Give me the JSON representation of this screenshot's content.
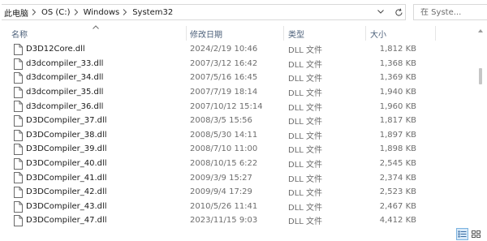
{
  "breadcrumb": {
    "items": [
      "此电脑",
      "OS (C:)",
      "Windows",
      "System32"
    ]
  },
  "search": {
    "placeholder": "在 Syste..."
  },
  "columns": {
    "name": "名称",
    "date": "修改日期",
    "type": "类型",
    "size": "大小"
  },
  "files": [
    {
      "name": "D3D12Core.dll",
      "date": "2024/2/19 10:46",
      "type": "DLL 文件",
      "size": "1,812 KB"
    },
    {
      "name": "d3dcompiler_33.dll",
      "date": "2007/3/12 16:42",
      "type": "DLL 文件",
      "size": "1,368 KB"
    },
    {
      "name": "d3dcompiler_34.dll",
      "date": "2007/5/16 16:45",
      "type": "DLL 文件",
      "size": "1,369 KB"
    },
    {
      "name": "d3dcompiler_35.dll",
      "date": "2007/7/19 18:14",
      "type": "DLL 文件",
      "size": "1,940 KB"
    },
    {
      "name": "d3dcompiler_36.dll",
      "date": "2007/10/12 15:14",
      "type": "DLL 文件",
      "size": "1,960 KB"
    },
    {
      "name": "D3DCompiler_37.dll",
      "date": "2008/3/5 15:56",
      "type": "DLL 文件",
      "size": "1,817 KB"
    },
    {
      "name": "D3DCompiler_38.dll",
      "date": "2008/5/30 14:11",
      "type": "DLL 文件",
      "size": "1,897 KB"
    },
    {
      "name": "D3DCompiler_39.dll",
      "date": "2008/7/10 11:00",
      "type": "DLL 文件",
      "size": "1,898 KB"
    },
    {
      "name": "D3DCompiler_40.dll",
      "date": "2008/10/15 6:22",
      "type": "DLL 文件",
      "size": "2,545 KB"
    },
    {
      "name": "D3DCompiler_41.dll",
      "date": "2009/3/9 15:27",
      "type": "DLL 文件",
      "size": "2,374 KB"
    },
    {
      "name": "D3DCompiler_42.dll",
      "date": "2009/9/4 17:29",
      "type": "DLL 文件",
      "size": "2,523 KB"
    },
    {
      "name": "D3DCompiler_43.dll",
      "date": "2010/5/26 11:41",
      "type": "DLL 文件",
      "size": "2,467 KB"
    },
    {
      "name": "D3DCompiler_47.dll",
      "date": "2023/11/15 9:03",
      "type": "DLL 文件",
      "size": "4,412 KB"
    }
  ],
  "icons": {
    "file": "dll-file-icon",
    "sort": "sort-ascending-icon",
    "search": "search-icon",
    "refresh": "refresh-icon",
    "dropdown": "chevron-down-icon",
    "breadcrumb_separator": "chevron-right-icon",
    "details_view": "details-view-icon",
    "tiles_view": "large-icons-view-icon"
  },
  "colors": {
    "header_text": "#4c607a",
    "secondary_text": "#6d6d6d",
    "primary_text": "#1a1a1a",
    "active_view_border": "#7bb3e0",
    "active_view_fill": "#d8e9f8"
  }
}
